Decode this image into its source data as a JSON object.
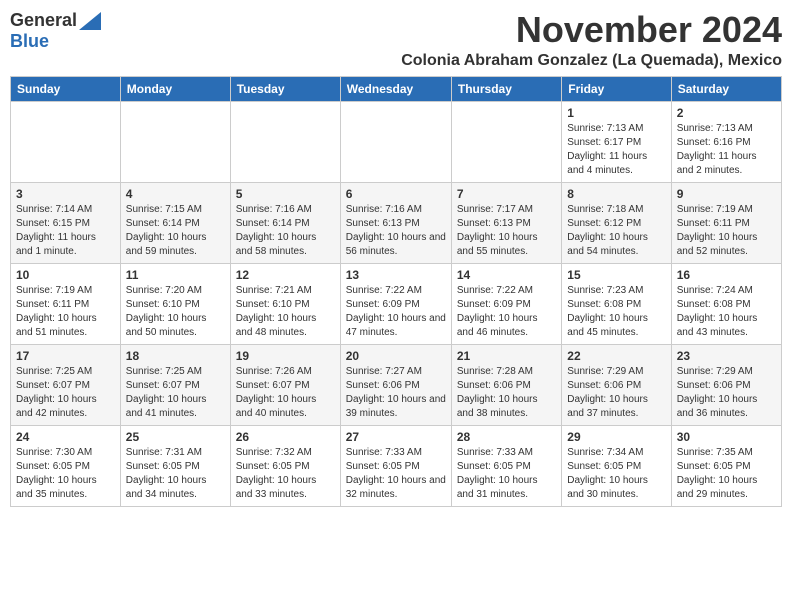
{
  "header": {
    "logo_general": "General",
    "logo_blue": "Blue",
    "month": "November 2024",
    "location": "Colonia Abraham Gonzalez (La Quemada), Mexico"
  },
  "weekdays": [
    "Sunday",
    "Monday",
    "Tuesday",
    "Wednesday",
    "Thursday",
    "Friday",
    "Saturday"
  ],
  "weeks": [
    [
      {
        "day": "",
        "info": ""
      },
      {
        "day": "",
        "info": ""
      },
      {
        "day": "",
        "info": ""
      },
      {
        "day": "",
        "info": ""
      },
      {
        "day": "",
        "info": ""
      },
      {
        "day": "1",
        "info": "Sunrise: 7:13 AM\nSunset: 6:17 PM\nDaylight: 11 hours and 4 minutes."
      },
      {
        "day": "2",
        "info": "Sunrise: 7:13 AM\nSunset: 6:16 PM\nDaylight: 11 hours and 2 minutes."
      }
    ],
    [
      {
        "day": "3",
        "info": "Sunrise: 7:14 AM\nSunset: 6:15 PM\nDaylight: 11 hours and 1 minute."
      },
      {
        "day": "4",
        "info": "Sunrise: 7:15 AM\nSunset: 6:14 PM\nDaylight: 10 hours and 59 minutes."
      },
      {
        "day": "5",
        "info": "Sunrise: 7:16 AM\nSunset: 6:14 PM\nDaylight: 10 hours and 58 minutes."
      },
      {
        "day": "6",
        "info": "Sunrise: 7:16 AM\nSunset: 6:13 PM\nDaylight: 10 hours and 56 minutes."
      },
      {
        "day": "7",
        "info": "Sunrise: 7:17 AM\nSunset: 6:13 PM\nDaylight: 10 hours and 55 minutes."
      },
      {
        "day": "8",
        "info": "Sunrise: 7:18 AM\nSunset: 6:12 PM\nDaylight: 10 hours and 54 minutes."
      },
      {
        "day": "9",
        "info": "Sunrise: 7:19 AM\nSunset: 6:11 PM\nDaylight: 10 hours and 52 minutes."
      }
    ],
    [
      {
        "day": "10",
        "info": "Sunrise: 7:19 AM\nSunset: 6:11 PM\nDaylight: 10 hours and 51 minutes."
      },
      {
        "day": "11",
        "info": "Sunrise: 7:20 AM\nSunset: 6:10 PM\nDaylight: 10 hours and 50 minutes."
      },
      {
        "day": "12",
        "info": "Sunrise: 7:21 AM\nSunset: 6:10 PM\nDaylight: 10 hours and 48 minutes."
      },
      {
        "day": "13",
        "info": "Sunrise: 7:22 AM\nSunset: 6:09 PM\nDaylight: 10 hours and 47 minutes."
      },
      {
        "day": "14",
        "info": "Sunrise: 7:22 AM\nSunset: 6:09 PM\nDaylight: 10 hours and 46 minutes."
      },
      {
        "day": "15",
        "info": "Sunrise: 7:23 AM\nSunset: 6:08 PM\nDaylight: 10 hours and 45 minutes."
      },
      {
        "day": "16",
        "info": "Sunrise: 7:24 AM\nSunset: 6:08 PM\nDaylight: 10 hours and 43 minutes."
      }
    ],
    [
      {
        "day": "17",
        "info": "Sunrise: 7:25 AM\nSunset: 6:07 PM\nDaylight: 10 hours and 42 minutes."
      },
      {
        "day": "18",
        "info": "Sunrise: 7:25 AM\nSunset: 6:07 PM\nDaylight: 10 hours and 41 minutes."
      },
      {
        "day": "19",
        "info": "Sunrise: 7:26 AM\nSunset: 6:07 PM\nDaylight: 10 hours and 40 minutes."
      },
      {
        "day": "20",
        "info": "Sunrise: 7:27 AM\nSunset: 6:06 PM\nDaylight: 10 hours and 39 minutes."
      },
      {
        "day": "21",
        "info": "Sunrise: 7:28 AM\nSunset: 6:06 PM\nDaylight: 10 hours and 38 minutes."
      },
      {
        "day": "22",
        "info": "Sunrise: 7:29 AM\nSunset: 6:06 PM\nDaylight: 10 hours and 37 minutes."
      },
      {
        "day": "23",
        "info": "Sunrise: 7:29 AM\nSunset: 6:06 PM\nDaylight: 10 hours and 36 minutes."
      }
    ],
    [
      {
        "day": "24",
        "info": "Sunrise: 7:30 AM\nSunset: 6:05 PM\nDaylight: 10 hours and 35 minutes."
      },
      {
        "day": "25",
        "info": "Sunrise: 7:31 AM\nSunset: 6:05 PM\nDaylight: 10 hours and 34 minutes."
      },
      {
        "day": "26",
        "info": "Sunrise: 7:32 AM\nSunset: 6:05 PM\nDaylight: 10 hours and 33 minutes."
      },
      {
        "day": "27",
        "info": "Sunrise: 7:33 AM\nSunset: 6:05 PM\nDaylight: 10 hours and 32 minutes."
      },
      {
        "day": "28",
        "info": "Sunrise: 7:33 AM\nSunset: 6:05 PM\nDaylight: 10 hours and 31 minutes."
      },
      {
        "day": "29",
        "info": "Sunrise: 7:34 AM\nSunset: 6:05 PM\nDaylight: 10 hours and 30 minutes."
      },
      {
        "day": "30",
        "info": "Sunrise: 7:35 AM\nSunset: 6:05 PM\nDaylight: 10 hours and 29 minutes."
      }
    ]
  ]
}
